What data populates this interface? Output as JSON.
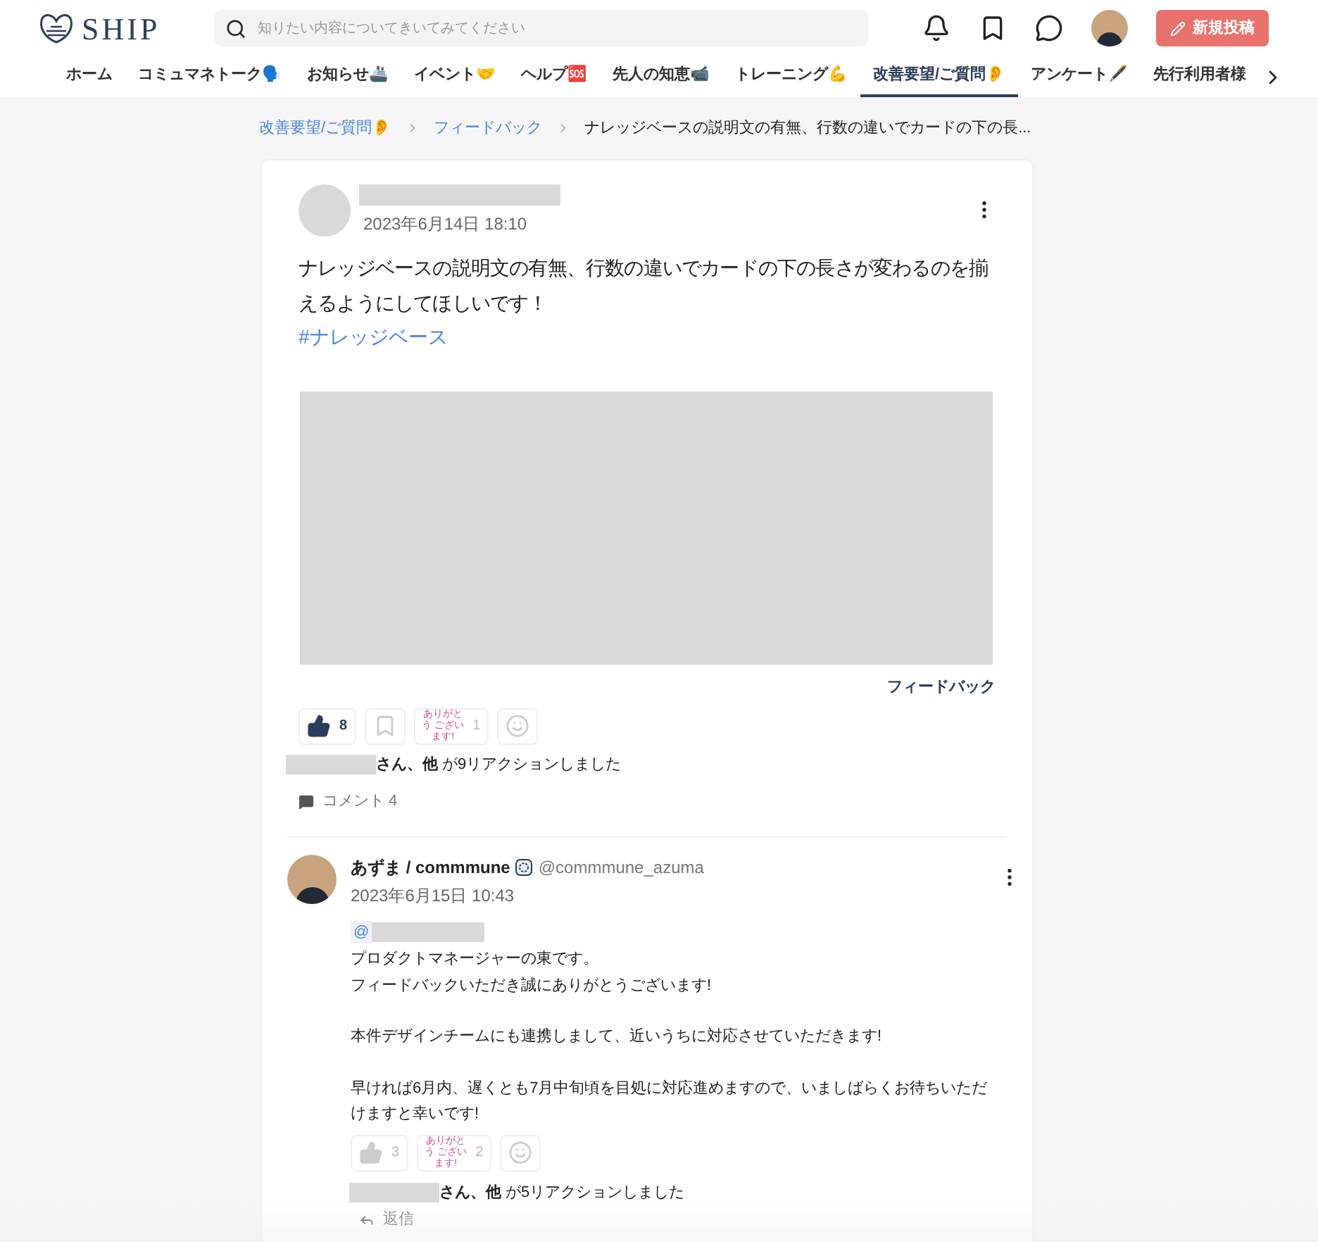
{
  "header": {
    "logo": "SHIP",
    "search": {
      "placeholder": "知りたい内容についてきいてみてください"
    },
    "new_post_button": "新規投稿"
  },
  "nav": [
    {
      "label": "ホーム",
      "selected": false
    },
    {
      "label": "コミュマネトーク🗣️",
      "selected": false
    },
    {
      "label": "お知らせ🚢",
      "selected": false
    },
    {
      "label": "イベント🤝",
      "selected": false
    },
    {
      "label": "ヘルプ🆘",
      "selected": false
    },
    {
      "label": "先人の知恵📹",
      "selected": false
    },
    {
      "label": "トレーニング💪",
      "selected": false
    },
    {
      "label": "改善要望/ご質問👂",
      "selected": true
    },
    {
      "label": "アンケート🖋️",
      "selected": false
    },
    {
      "label": "先行利用者様",
      "selected": false
    }
  ],
  "breadcrumb": [
    {
      "label": "改善要望/ご質問👂",
      "kind": "link"
    },
    {
      "label": "フィードバック",
      "kind": "link"
    },
    {
      "label": "ナレッジベースの説明文の有無、行数の違いでカードの下の長...",
      "kind": "current"
    }
  ],
  "post": {
    "date": "2023年6月14日 18:10",
    "body": "ナレッジベースの説明文の有無、行数の違いでカードの下の長さが変わるのを揃えるようにしてほしいです！",
    "hashtag": "#ナレッジベース",
    "category": "フィードバック",
    "reactions": [
      {
        "kind": "like",
        "count": "8",
        "selected": true
      },
      {
        "kind": "bookmark",
        "selected": false
      },
      {
        "kind": "sticker",
        "text": "ありがとう ございます!",
        "count": "1"
      },
      {
        "kind": "add"
      }
    ],
    "reaction_summary": {
      "bold": "さん、他",
      "rest": " が9リアクションしました"
    },
    "comments": "コメント 4"
  },
  "comment": {
    "author": "あずま / commmune",
    "handle": "@commmune_azuma",
    "date": "2023年6月15日 10:43",
    "mention": "@",
    "paragraphs": [
      [
        "プロダクトマネージャーの東です。",
        "フィードバックいただき誠にありがとうございます!"
      ],
      [
        "本件デザインチームにも連携しまして、近いうちに対応させていただきます!"
      ],
      [
        "早ければ6月内、遅くとも7月中旬頃を目処に対応進めますので、いましばらくお待ちいただけますと幸いです!"
      ]
    ],
    "reactions": [
      {
        "kind": "like",
        "count": "3",
        "selected": false
      },
      {
        "kind": "sticker",
        "text": "ありがとう ございます!",
        "count": "2"
      },
      {
        "kind": "add"
      }
    ],
    "reaction_summary": {
      "bold": "さん、他",
      "rest": " が5リアクションしました"
    },
    "reply": "返信"
  }
}
